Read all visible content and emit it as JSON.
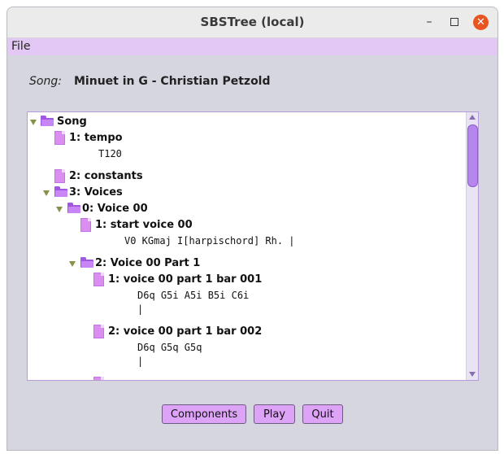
{
  "window": {
    "title": "SBSTree (local)",
    "controls": {
      "minimize": "–",
      "maximize": "",
      "close": "✕"
    }
  },
  "menubar": {
    "file_label": "File"
  },
  "song": {
    "label": "Song:",
    "title": "Minuet in G - Christian Petzold"
  },
  "tree": {
    "nodes": [
      {
        "label": "Song",
        "type": "folder",
        "expanded": true,
        "depth": 0
      },
      {
        "label": "1:  tempo",
        "type": "leaf",
        "depth": 1,
        "content": "T120"
      },
      {
        "label": "2:  constants",
        "type": "leaf",
        "depth": 1
      },
      {
        "label": "3:  Voices",
        "type": "folder",
        "expanded": true,
        "depth": 1
      },
      {
        "label": "0:  Voice 00",
        "type": "folder",
        "expanded": true,
        "depth": 2
      },
      {
        "label": "1:  start voice 00",
        "type": "leaf",
        "depth": 3,
        "content": "V0 KGmaj I[harpischord] Rh. |"
      },
      {
        "label": "2:  Voice 00 Part 1",
        "type": "folder",
        "expanded": true,
        "depth": 3
      },
      {
        "label": "1:  voice 00 part 1 bar 001",
        "type": "leaf",
        "depth": 4,
        "content": "D6q G5i A5i B5i C6i",
        "content2": "|"
      },
      {
        "label": "2:  voice 00 part 1 bar 002",
        "type": "leaf",
        "depth": 4,
        "content": "D6q G5q G5q",
        "content2": "|"
      }
    ]
  },
  "buttons": {
    "components": "Components",
    "play": "Play",
    "quit": "Quit"
  },
  "colors": {
    "accent": "#dca3f6",
    "menubar": "#e3c7f5",
    "folder": "#a257e4",
    "close": "#e95420"
  }
}
